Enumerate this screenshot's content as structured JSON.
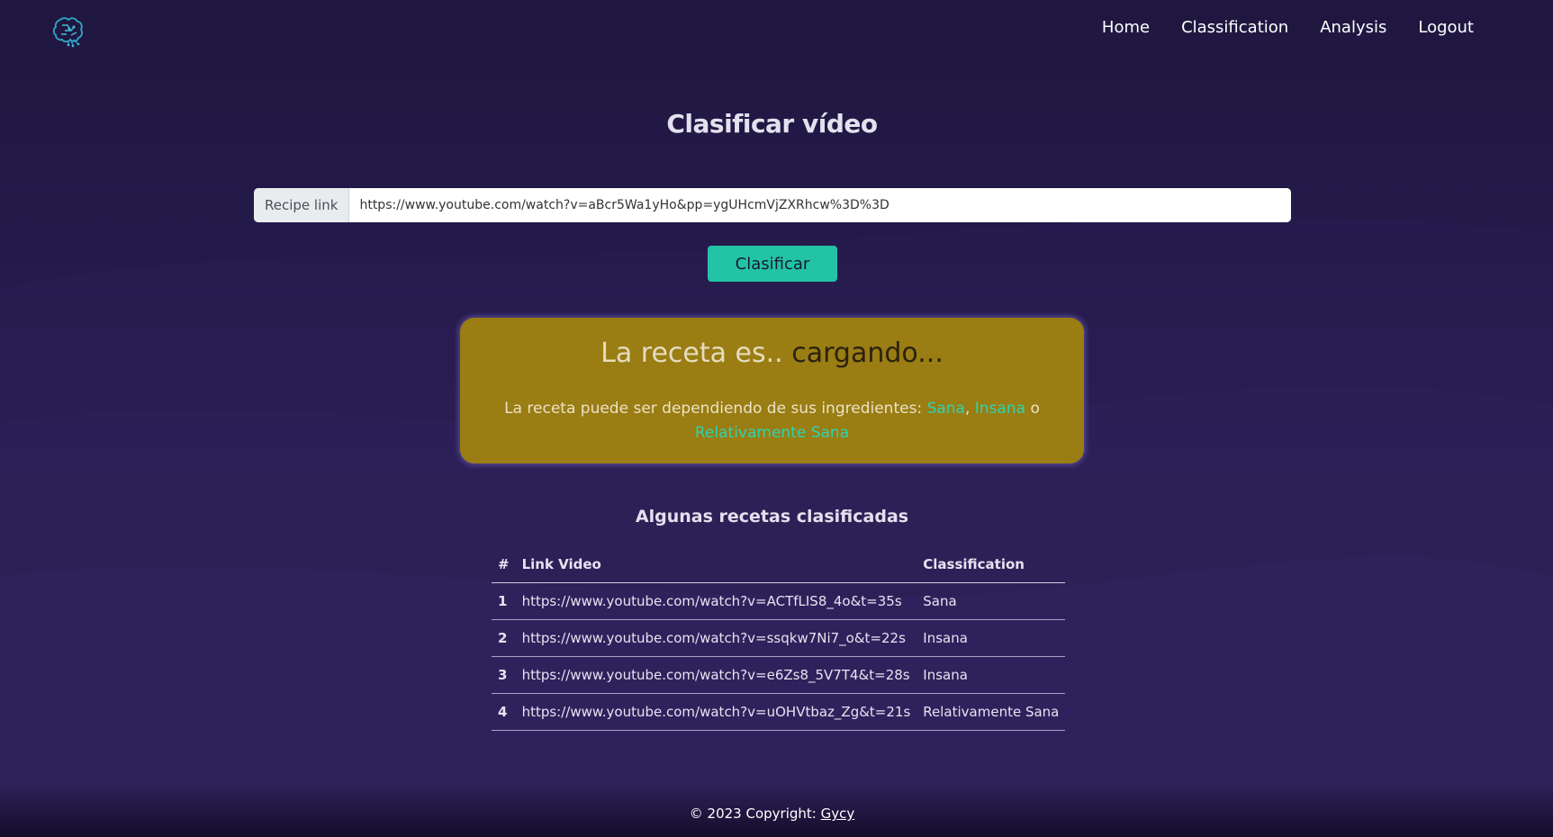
{
  "nav": {
    "logo_icon": "brain-circuit-icon",
    "links": [
      "Home",
      "Classification",
      "Analysis",
      "Logout"
    ]
  },
  "main": {
    "title": "Clasificar vídeo",
    "url_label": "Recipe link",
    "url_value": "https://www.youtube.com/watch?v=aBcr5Wa1yHo&pp=ygUHcmVjZXRhcw%3D%3D",
    "button_label": "Clasificar"
  },
  "result": {
    "prefix": "La receta es.. ",
    "state": "cargando...",
    "desc_prefix": "La receta puede ser dependiendo de sus ingredientes: ",
    "tag1": "Sana",
    "sep": ", ",
    "tag2": "Insana",
    "or": " o ",
    "tag3": "Relativamente Sana"
  },
  "table": {
    "title": "Algunas recetas clasificadas",
    "headers": [
      "#",
      "Link Video",
      "Classification"
    ],
    "rows": [
      {
        "num": "1",
        "link": "https://www.youtube.com/watch?v=ACTfLIS8_4o&t=35s",
        "classification": "Sana"
      },
      {
        "num": "2",
        "link": "https://www.youtube.com/watch?v=ssqkw7Ni7_o&t=22s",
        "classification": "Insana"
      },
      {
        "num": "3",
        "link": "https://www.youtube.com/watch?v=e6Zs8_5V7T4&t=28s",
        "classification": "Insana"
      },
      {
        "num": "4",
        "link": "https://www.youtube.com/watch?v=uOHVtbaz_Zg&t=21s",
        "classification": "Relativamente Sana"
      }
    ]
  },
  "footer": {
    "text": "© 2023 Copyright: ",
    "link": "Gycy"
  },
  "colors": {
    "background": "#241a4a",
    "accent": "#22c3a6",
    "result_card": "#9a7d13",
    "tag": "#2fd3b0"
  }
}
